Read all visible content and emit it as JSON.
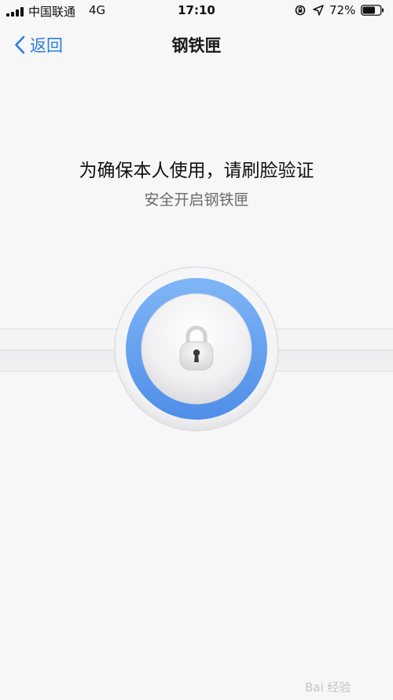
{
  "status_bar": {
    "carrier": "中国联通",
    "network": "4G",
    "time": "17:10",
    "battery_percent": "72%",
    "battery_level": 0.72,
    "icons": [
      "signal-icon",
      "rotation-lock-icon",
      "location-icon",
      "battery-icon"
    ]
  },
  "nav": {
    "back_label": "返回",
    "title": "钢铁匣",
    "back_icon": "chevron-left-icon"
  },
  "main": {
    "prompt": "为确保本人使用，请刷脸验证",
    "subtitle": "安全开启钢铁匣",
    "lock_icon": "keyhole-lock-icon"
  },
  "watermark": {
    "text": "Bai 经验"
  },
  "colors": {
    "accent": "#2a7be6",
    "ring_blue": "#5a9af0",
    "background": "#f7f7f8"
  }
}
